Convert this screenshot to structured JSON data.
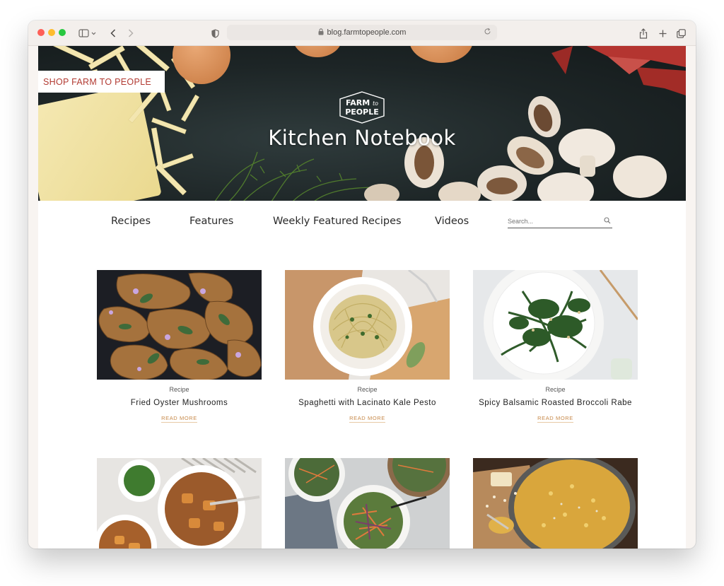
{
  "browser": {
    "url": "blog.farmtopeople.com"
  },
  "hero": {
    "shop_button": "SHOP FARM TO PEOPLE",
    "logo_line1": "FARM",
    "logo_to": "to",
    "logo_line2": "PEOPLE",
    "title": "Kitchen Notebook"
  },
  "nav": {
    "items": [
      "Recipes",
      "Features",
      "Weekly Featured Recipes",
      "Videos"
    ],
    "search_placeholder": "Search..."
  },
  "cards": [
    {
      "category": "Recipe",
      "title": "Fried Oyster Mushrooms",
      "link": "READ MORE"
    },
    {
      "category": "Recipe",
      "title": "Spaghetti with Lacinato Kale Pesto",
      "link": "READ MORE"
    },
    {
      "category": "Recipe",
      "title": "Spicy Balsamic Roasted Broccoli Rabe",
      "link": "READ MORE"
    }
  ],
  "colors": {
    "accent": "#c78a4a",
    "shop_text": "#b23a32"
  }
}
